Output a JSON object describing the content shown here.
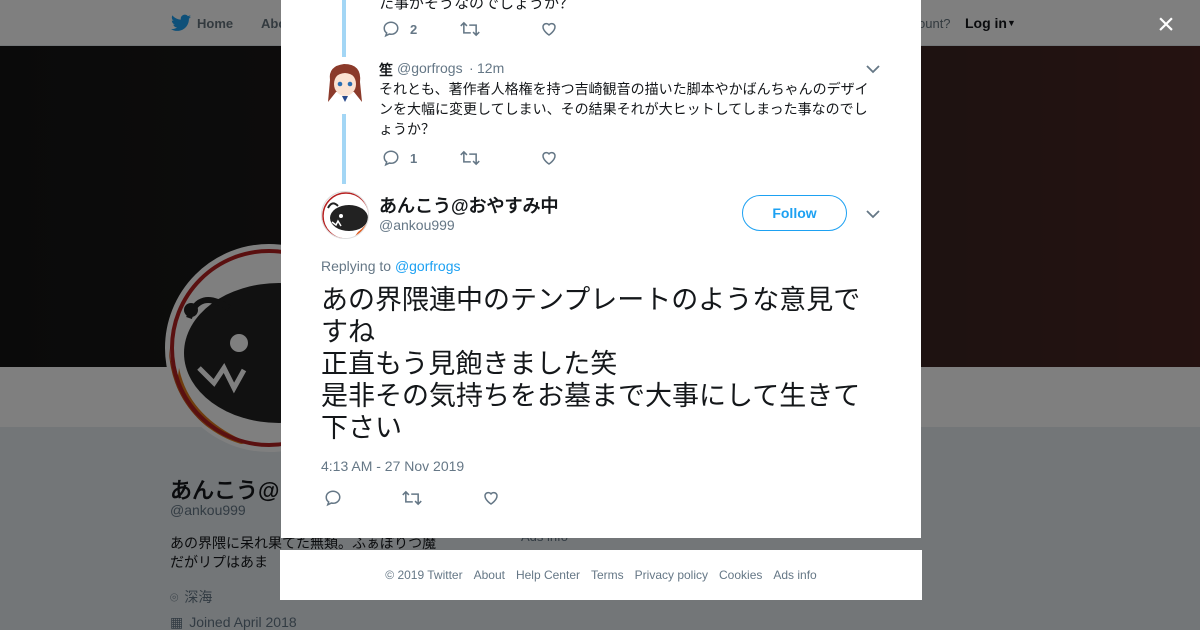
{
  "topnav": {
    "home_label": "Home",
    "about_label": "Abo",
    "account_prompt": "ccount?",
    "login_label": "Log in"
  },
  "profile": {
    "name": "あんこう@",
    "handle": "@ankou999",
    "bio": "あの界隈に呆れ果てた無類。ふぁぼりつ魔だがリプはあま",
    "location": "深海",
    "joined": "Joined April 2018",
    "background_tab_label": "Ads info"
  },
  "modal": {
    "context_cut_text": "た事がそうなのでしょうか？",
    "context_actions": {
      "reply_count": "2"
    },
    "reply_tweet": {
      "name": "笙",
      "handle": "@gorfrogs",
      "separator": "·",
      "time": "12m",
      "text": "それとも、著作者人格権を持つ吉崎観音の描いた脚本やかばんちゃんのデザインを大幅に変更してしまい、その結果それが大ヒットしてしまった事なのでしょうか？",
      "reply_count": "1"
    },
    "main_tweet": {
      "name": "あんこう@おやすみ中",
      "handle": "@ankou999",
      "follow_label": "Follow",
      "replying_prefix": "Replying to",
      "replying_to": "@gorfrogs",
      "text": "あの界隈連中のテンプレートのような意見ですね\n正直もう見飽きました笑\n是非その気持ちをお墓まで大事にして生きて下さい",
      "date": "4:13 AM - 27 Nov 2019"
    }
  },
  "footer": {
    "copyright": "© 2019 Twitter",
    "links": [
      "About",
      "Help Center",
      "Terms",
      "Privacy policy",
      "Cookies",
      "Ads info"
    ]
  },
  "colors": {
    "accent": "#1da1f2",
    "muted_text": "#657786",
    "thread_line": "#a3d6f5",
    "overlay": "#7f7f7f"
  },
  "icons": [
    "twitter-bird-icon",
    "reply-icon",
    "retweet-icon",
    "like-icon",
    "chevron-down-icon",
    "close-icon",
    "location-pin-icon",
    "calendar-icon"
  ]
}
